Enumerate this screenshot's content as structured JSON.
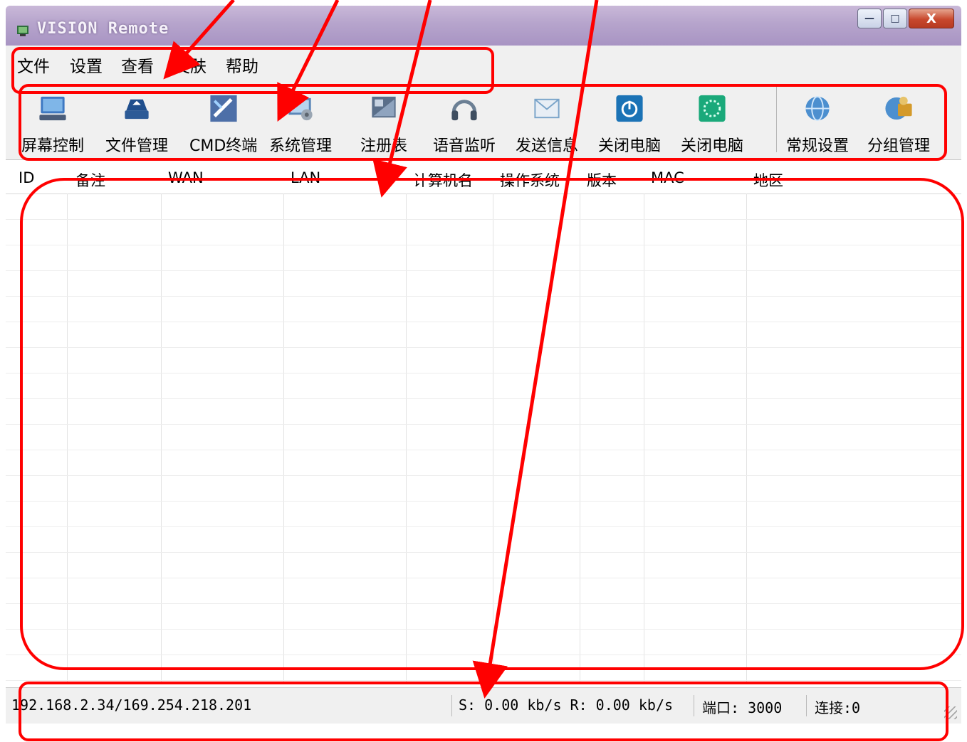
{
  "window": {
    "title": "VISION Remote",
    "minimize_glyph": "—",
    "maximize_glyph": "□",
    "close_glyph": "X"
  },
  "menu": [
    "文件",
    "设置",
    "查看",
    "皮肤",
    "帮助"
  ],
  "toolbar": {
    "items": [
      {
        "label": "屏幕控制",
        "icon": "monitor-icon",
        "color": "#3d78c2"
      },
      {
        "label": "文件管理",
        "icon": "file-manager-icon",
        "color": "#1f4e8d"
      },
      {
        "label": "CMD终端",
        "icon": "cmd-terminal-icon",
        "color": "#4d6fa8"
      },
      {
        "label": "系统管理",
        "icon": "system-manager-icon",
        "color": "#5b86b8"
      },
      {
        "label": "注册表",
        "icon": "registry-icon",
        "color": "#5a6f8a"
      },
      {
        "label": "语音监听",
        "icon": "headphones-icon",
        "color": "#6b7f94"
      },
      {
        "label": "发送信息",
        "icon": "message-icon",
        "color": "#7aa4c9"
      },
      {
        "label": "关闭电脑",
        "icon": "power-icon",
        "color": "#1b73b6"
      },
      {
        "label": "关闭电脑",
        "icon": "restart-icon",
        "color": "#1aa97a"
      },
      {
        "label": "常规设置",
        "icon": "settings-globe-icon",
        "color": "#4c8fcf"
      },
      {
        "label": "分组管理",
        "icon": "group-manager-icon",
        "color": "#d49a2a"
      }
    ]
  },
  "table": {
    "columns": [
      "ID",
      "备注",
      "WAN",
      "LAN",
      "计算机名",
      "操作系统",
      "版本",
      "MAC",
      "地区"
    ],
    "rows": []
  },
  "status": {
    "ip": "192.168.2.34/169.254.218.201",
    "speed": "S: 0.00 kb/s R: 0.00 kb/s",
    "port": "端口: 3000",
    "connections": "连接:0"
  },
  "annotation_color": "#ff0000"
}
